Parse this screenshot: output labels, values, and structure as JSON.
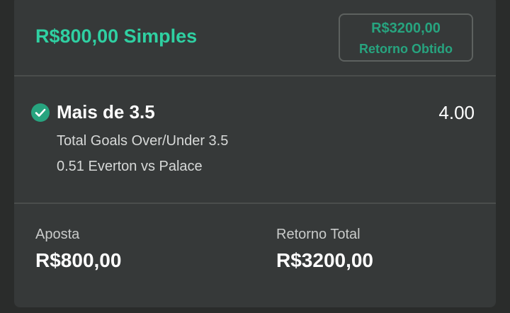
{
  "bet": {
    "title": "R$800,00 Simples",
    "cashout": {
      "amount": "R$3200,00",
      "label": "Retorno Obtido"
    },
    "selection": {
      "name": "Mais de 3.5",
      "odds": "4.00",
      "market": "Total Goals Over/Under 3.5",
      "event": "0.51 Everton vs Palace",
      "status_icon": "check-circle-icon"
    },
    "stake": {
      "label": "Aposta",
      "value": "R$800,00"
    },
    "total_return": {
      "label": "Retorno Total",
      "value": "R$3200,00"
    }
  },
  "colors": {
    "background": "#2a2c2b",
    "card": "#363939",
    "accent": "#2fd0a2",
    "accent_dark": "#27a47f",
    "text_primary": "#ffffff",
    "text_secondary": "#d7d9d8"
  }
}
